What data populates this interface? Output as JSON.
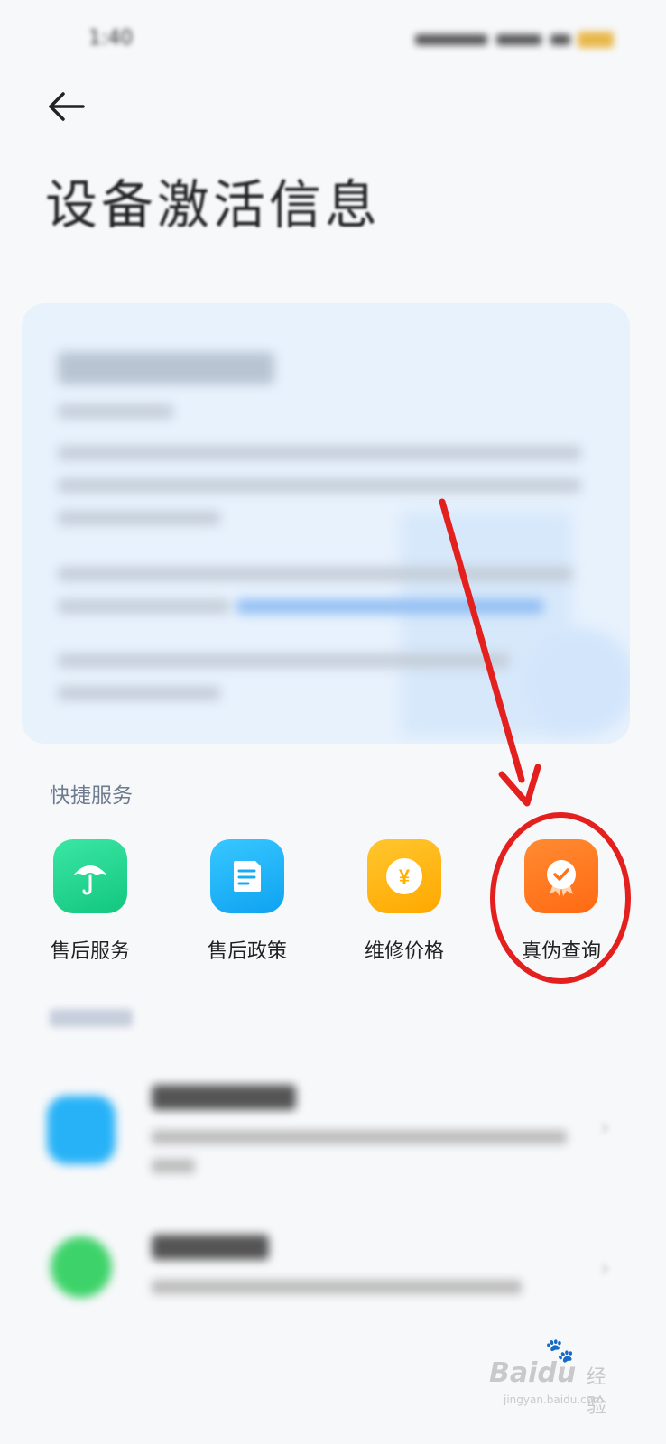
{
  "status_bar": {
    "time": "1:40"
  },
  "header": {
    "title": "设备激活信息"
  },
  "quick_services": {
    "label": "快捷服务",
    "items": [
      {
        "label": "售后服务",
        "icon": "umbrella-icon",
        "color": "#1fd68f"
      },
      {
        "label": "售后政策",
        "icon": "document-icon",
        "color": "#1ab4f7"
      },
      {
        "label": "维修价格",
        "icon": "yen-coin-icon",
        "color": "#ffb514"
      },
      {
        "label": "真伪查询",
        "icon": "checkmark-badge-icon",
        "color": "#ff7a1e"
      }
    ]
  },
  "colors": {
    "annotation": "#e4201f",
    "card_background": "#e8f2fd",
    "link": "#6fa9ef"
  },
  "watermark": {
    "brand": "Baidu",
    "sub": "经验",
    "url": "jingyan.baidu.com"
  }
}
